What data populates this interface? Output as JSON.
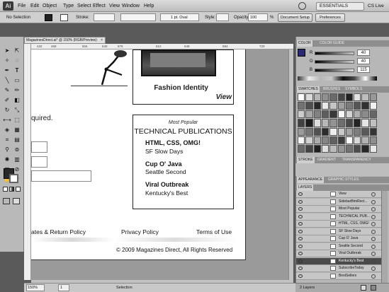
{
  "app": {
    "logo": "Ai"
  },
  "menu": [
    "File",
    "Edit",
    "Object",
    "Type",
    "Select",
    "Effect",
    "View",
    "Window",
    "Help"
  ],
  "workspace": {
    "label": "ESSENTIALS",
    "cs_live": "CS Live"
  },
  "control_bar": {
    "selection": "No Selection",
    "stroke_label": "Stroke:",
    "brush": "1 pt. Oval",
    "style_label": "Style:",
    "opacity_label": "Opacity:",
    "opacity_value": "100",
    "opacity_unit": "%",
    "document_setup": "Document Setup",
    "preferences": "Preferences"
  },
  "document": {
    "tab": "MagazinesDirect.ai* @ 150% (RGB/Preview)"
  },
  "ruler": {
    "ticks": [
      "432",
      "468",
      "504",
      "540",
      "576",
      "612",
      "648",
      "684",
      "720"
    ]
  },
  "artboard": {
    "feature_title": "Fashion Identity",
    "feature_sub": "View",
    "required": "quired.",
    "pubs": {
      "subtitle": "Most Popular",
      "title": "TECHNICAL PUBLICATIONS",
      "items": [
        {
          "title": "HTML, CSS, OMG!",
          "sub": "SF Slow Days"
        },
        {
          "title": "Cup O' Java",
          "sub": "Seattle Second"
        },
        {
          "title": "Viral Outbreak",
          "sub": "Kentucky's Best"
        }
      ]
    },
    "footer_links": [
      "ates & Return Policy",
      "Privacy Policy",
      "Terms of Use"
    ],
    "copyright": "© 2009 Magazines Direct, All Rights Reserved"
  },
  "status": {
    "zoom": "150%",
    "page": "1",
    "mode": "Selection"
  },
  "color_panel": {
    "tabs": [
      "COLOR",
      "COLOR GUIDE"
    ],
    "channels": [
      {
        "label": "R",
        "value": "40"
      },
      {
        "label": "G",
        "value": "40"
      },
      {
        "label": "B",
        "value": "115"
      }
    ]
  },
  "swatches_panel": {
    "tabs": [
      "SWATCHES",
      "BRUSHES",
      "SYMBOLS"
    ]
  },
  "stroke_panel": {
    "tabs": [
      "STROKE",
      "GRADIENT",
      "TRANSPARENCY"
    ]
  },
  "appearance_panel": {
    "tabs": [
      "APPEARANCE",
      "GRAPHIC STYLES"
    ]
  },
  "layers_panel": {
    "tab": "LAYERS",
    "rows": [
      "View",
      "SidebarBtmRect...",
      "Most Popular",
      "TECHNICAL PUB...",
      "HTML, CSS, OMG!",
      "SF Slow Days",
      "Cup O' Java",
      "Seattle Second",
      "Viral Outbreak",
      "Kentucky's Best",
      "SubscribeToday",
      "BestSellers"
    ],
    "selected_row": "Kentucky's Best",
    "footer": "2 Layers"
  }
}
